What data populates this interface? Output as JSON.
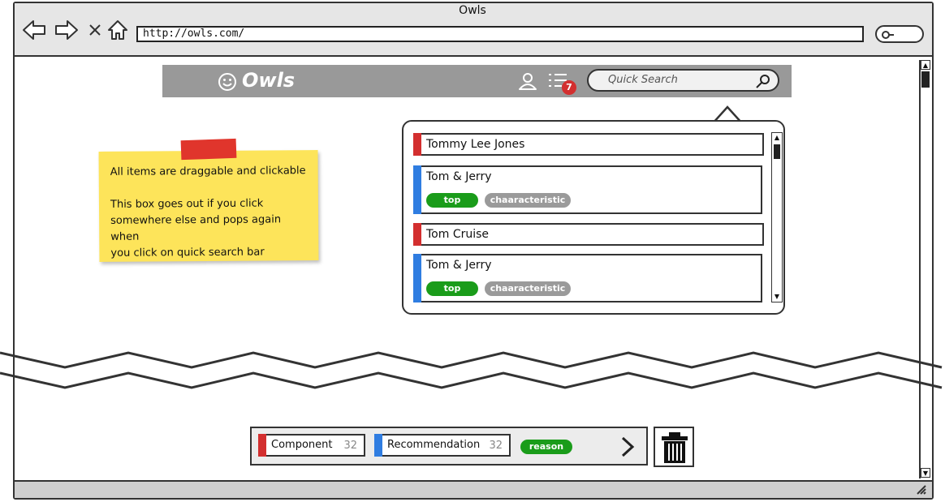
{
  "window": {
    "title": "Owls"
  },
  "browser": {
    "url": "http://owls.com/",
    "buttons": {
      "back": "arrow-left-icon",
      "forward": "arrow-right-icon",
      "stop": "close-icon",
      "home": "home-icon",
      "search": "search-icon"
    }
  },
  "app": {
    "logo_text": "Owls",
    "logo_icon": "smiley-icon",
    "user_icon": "user-icon",
    "list_icon": "list-icon",
    "notification_count": "7",
    "search_placeholder": "Quick Search",
    "colors": {
      "header_bg": "#999999",
      "accent_red": "#d32f2f",
      "accent_blue": "#2f7de1",
      "tag_green": "#1a9c1a",
      "tag_gray": "#9a9a9a",
      "note_yellow": "#fde45a"
    }
  },
  "note": {
    "line1": "All items are draggable and clickable",
    "line2": "This box goes out if you click",
    "line3": "somewhere else and pops again when",
    "line4": "you click on quick search bar"
  },
  "results": [
    {
      "title": "Tommy Lee Jones",
      "color": "red"
    },
    {
      "title": "Tom & Jerry",
      "color": "blue",
      "tags": [
        "top",
        "chaaracteristic"
      ]
    },
    {
      "title": "Tom Cruise",
      "color": "red"
    },
    {
      "title": "Tom & Jerry",
      "color": "blue",
      "tags": [
        "top",
        "chaaracteristic"
      ]
    }
  ],
  "bottom_bar": {
    "chips": [
      {
        "label": "Component",
        "count": "32",
        "color": "red"
      },
      {
        "label": "Recommendation",
        "count": "32",
        "color": "blue"
      }
    ],
    "reason_tag": "reason",
    "next_icon": "chevron-right-icon",
    "trash_icon": "trash-icon"
  }
}
